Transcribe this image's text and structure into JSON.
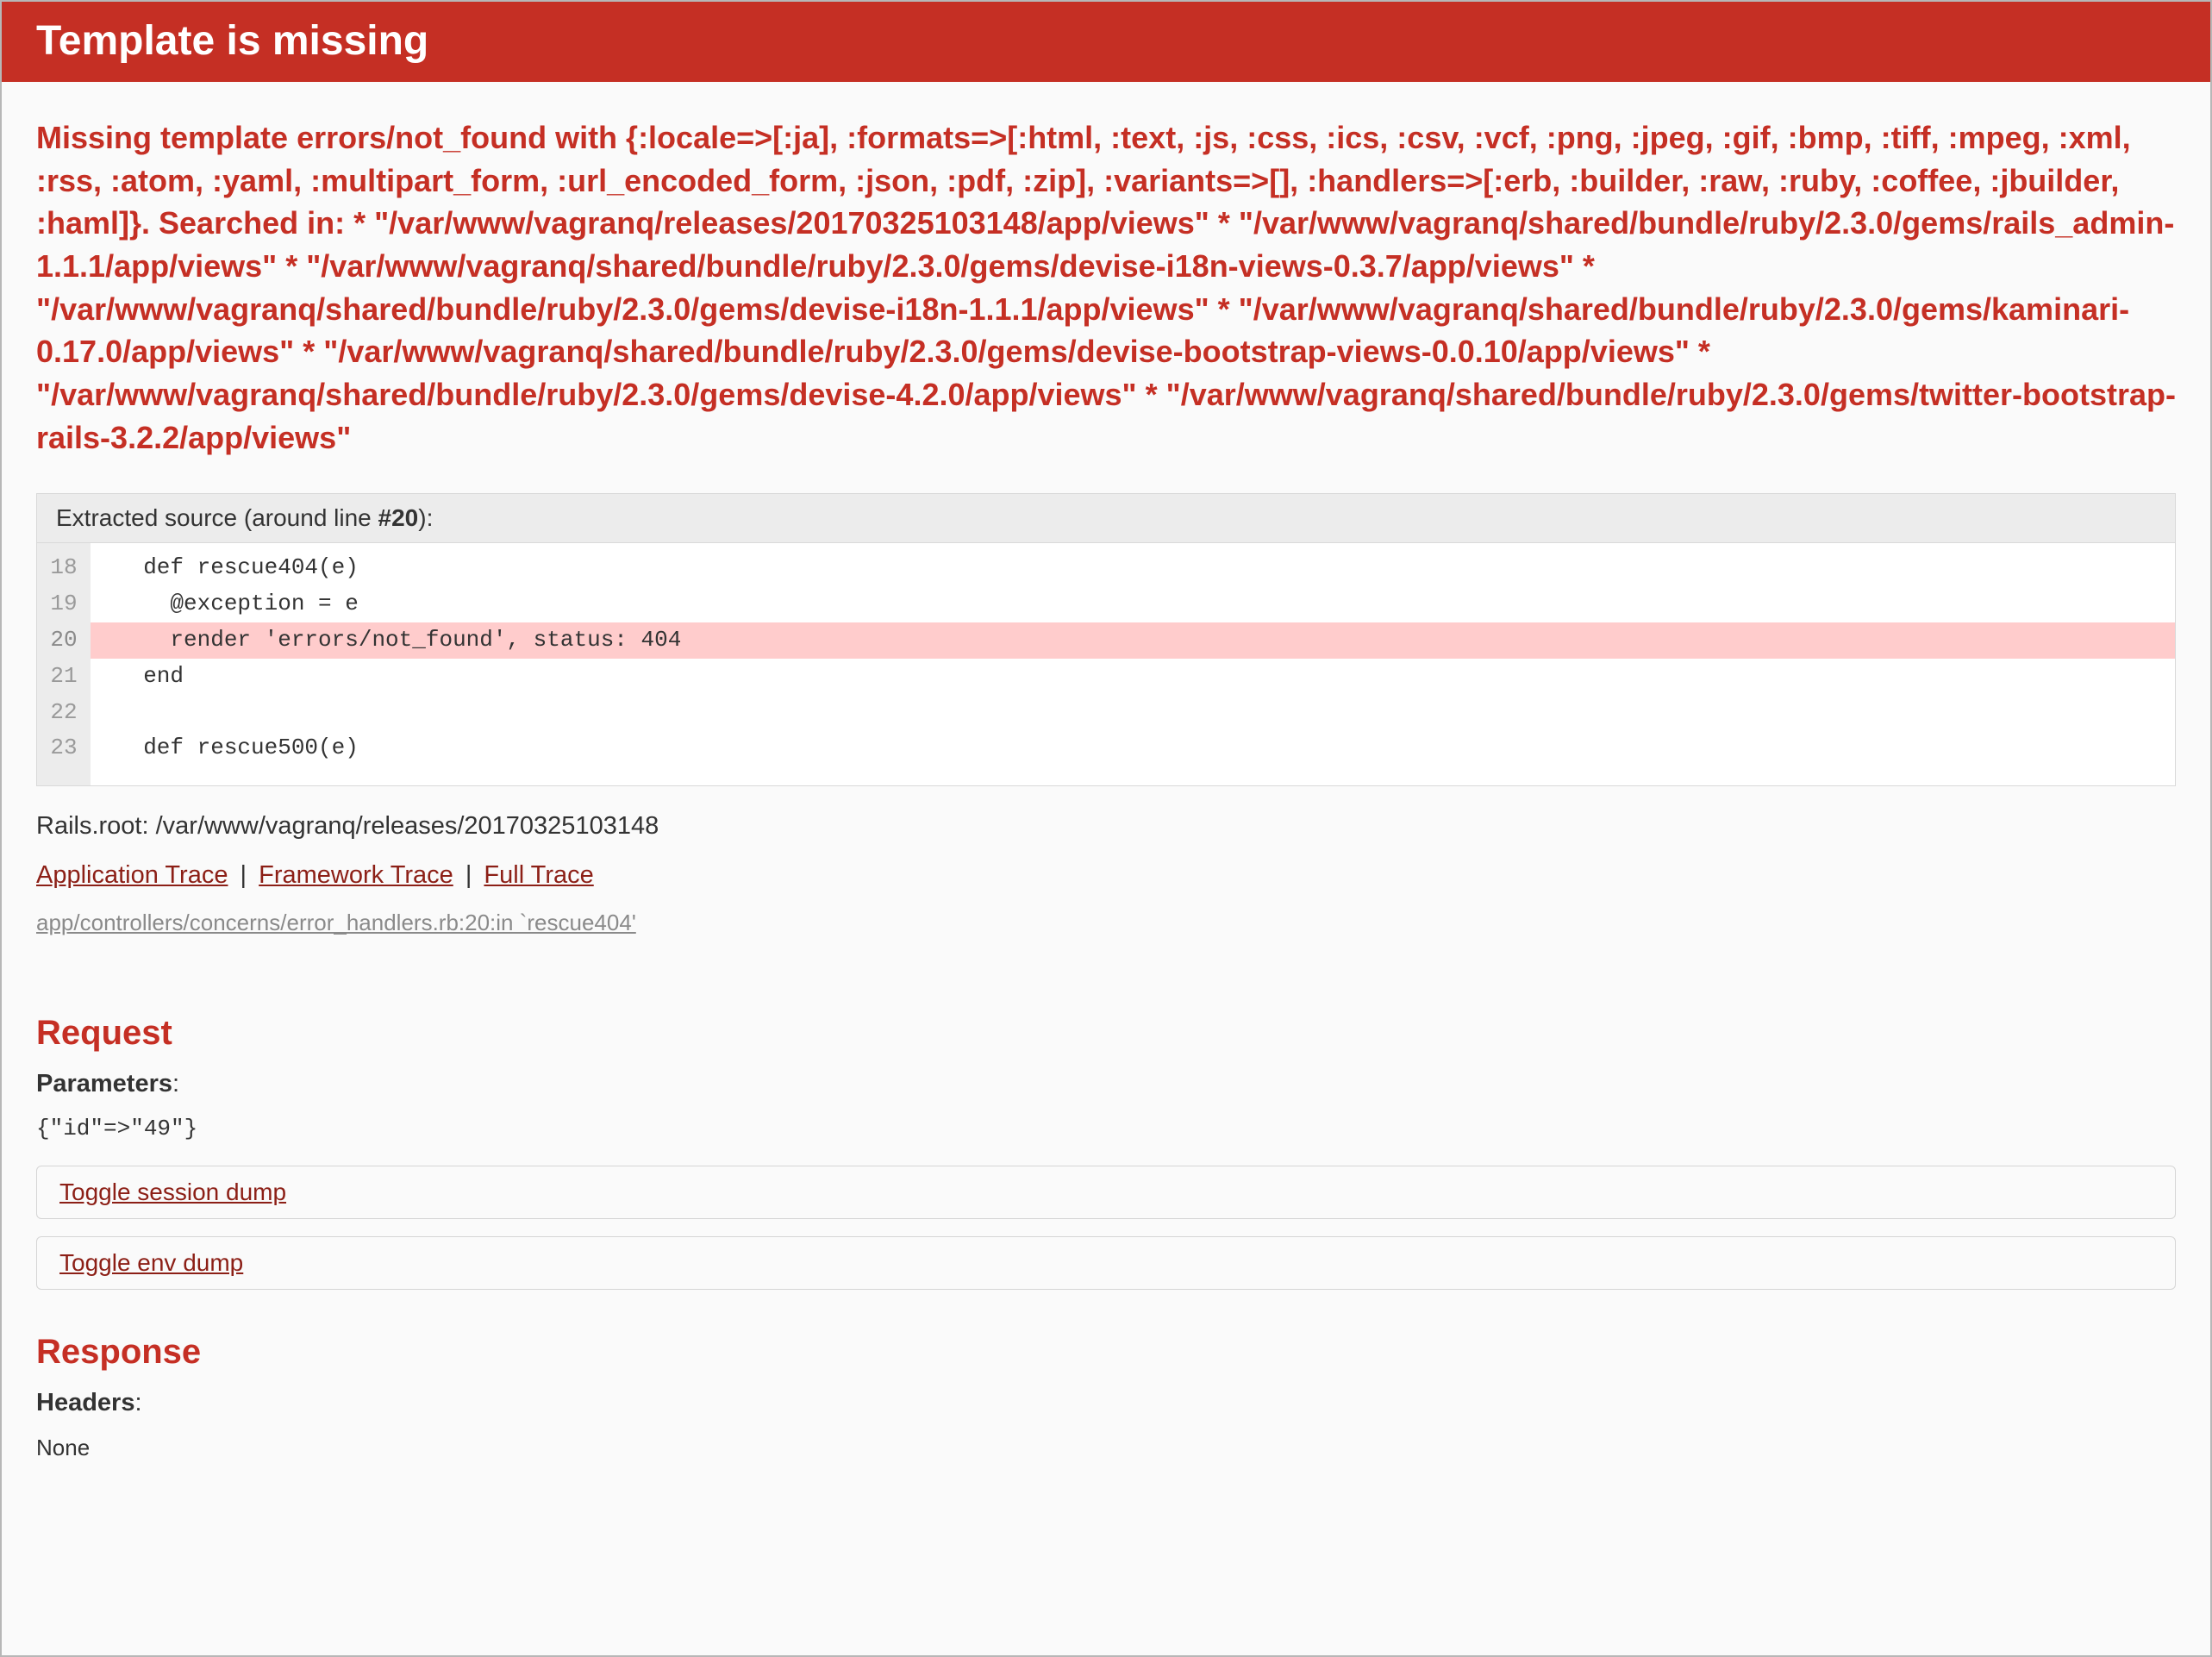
{
  "header": {
    "title": "Template is missing"
  },
  "error_message": "Missing template errors/not_found with {:locale=>[:ja], :formats=>[:html, :text, :js, :css, :ics, :csv, :vcf, :png, :jpeg, :gif, :bmp, :tiff, :mpeg, :xml, :rss, :atom, :yaml, :multipart_form, :url_encoded_form, :json, :pdf, :zip], :variants=>[], :handlers=>[:erb, :builder, :raw, :ruby, :coffee, :jbuilder, :haml]}. Searched in: * \"/var/www/vagranq/releases/20170325103148/app/views\" * \"/var/www/vagranq/shared/bundle/ruby/2.3.0/gems/rails_admin-1.1.1/app/views\" * \"/var/www/vagranq/shared/bundle/ruby/2.3.0/gems/devise-i18n-views-0.3.7/app/views\" * \"/var/www/vagranq/shared/bundle/ruby/2.3.0/gems/devise-i18n-1.1.1/app/views\" * \"/var/www/vagranq/shared/bundle/ruby/2.3.0/gems/kaminari-0.17.0/app/views\" * \"/var/www/vagranq/shared/bundle/ruby/2.3.0/gems/devise-bootstrap-views-0.0.10/app/views\" * \"/var/www/vagranq/shared/bundle/ruby/2.3.0/gems/devise-4.2.0/app/views\" * \"/var/www/vagranq/shared/bundle/ruby/2.3.0/gems/twitter-bootstrap-rails-3.2.2/app/views\"",
  "source": {
    "header_prefix": "Extracted source (around line ",
    "header_line": "#20",
    "header_suffix": "):",
    "highlighted_line": 20,
    "lines": [
      {
        "num": "18",
        "code": "  def rescue404(e)"
      },
      {
        "num": "19",
        "code": "    @exception = e"
      },
      {
        "num": "20",
        "code": "    render 'errors/not_found', status: 404"
      },
      {
        "num": "21",
        "code": "  end"
      },
      {
        "num": "22",
        "code": ""
      },
      {
        "num": "23",
        "code": "  def rescue500(e)"
      }
    ]
  },
  "rails_root": "Rails.root: /var/www/vagranq/releases/20170325103148",
  "trace_links": {
    "application": "Application Trace",
    "framework": "Framework Trace",
    "full": "Full Trace"
  },
  "trace_line": "app/controllers/concerns/error_handlers.rb:20:in `rescue404'",
  "request": {
    "heading": "Request",
    "parameters_label": "Parameters",
    "parameters_value": "{\"id\"=>\"49\"}",
    "toggle_session": "Toggle session dump",
    "toggle_env": "Toggle env dump"
  },
  "response": {
    "heading": "Response",
    "headers_label": "Headers",
    "headers_value": "None"
  }
}
